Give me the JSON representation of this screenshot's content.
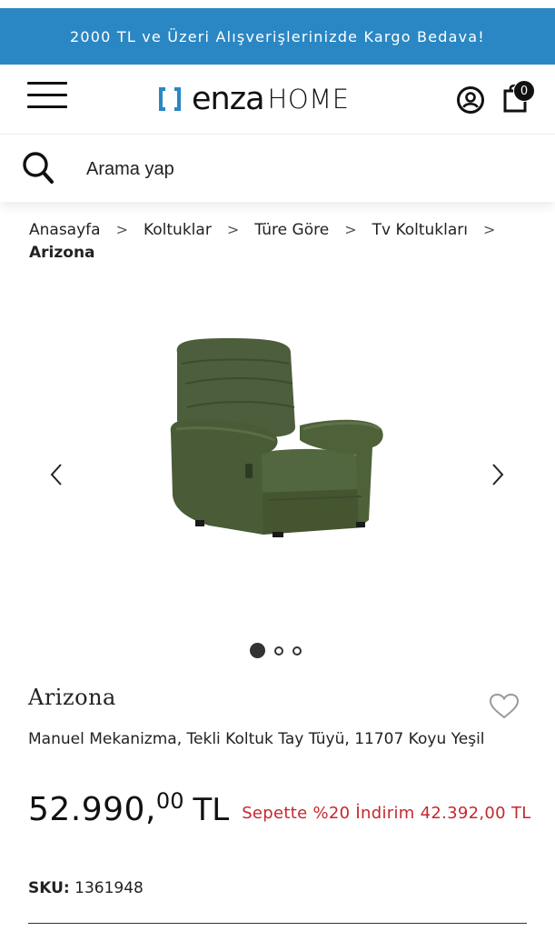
{
  "promo_bar": {
    "text": "2000 TL ve Üzeri Alışverişlerinizde Kargo Bedava!"
  },
  "header": {
    "logo_word": "enza",
    "logo_home": "HOME",
    "cart_count": "0"
  },
  "search": {
    "placeholder": "Arama yap"
  },
  "breadcrumb": {
    "items": [
      "Anasayfa",
      "Koltuklar",
      "Türe Göre",
      "Tv Koltukları"
    ],
    "current": "Arizona"
  },
  "product": {
    "name": "Arizona",
    "description": "Manuel Mekanizma, Tekli Koltuk Tay Tüyü, 11707 Koyu Yeşil",
    "price_integer": "52.990,",
    "price_decimal": "00",
    "currency": "TL",
    "cart_discount": "Sepette %20 İndirim 42.392,00 TL",
    "sku_label": "SKU:",
    "sku_value": "1361948"
  },
  "carousel": {
    "slide_count": 3,
    "active_index": 0
  },
  "colors": {
    "promo_bg": "#2a87c4",
    "logo_blue": "#2a87c4",
    "discount_red": "#c5282d",
    "chair_green": "#4c5e3b"
  },
  "icons": {
    "menu": "hamburger-icon",
    "user": "user-icon",
    "cart": "cart-icon",
    "search": "search-icon",
    "prev": "chevron-left-icon",
    "next": "chevron-right-icon",
    "favorite": "heart-icon"
  }
}
